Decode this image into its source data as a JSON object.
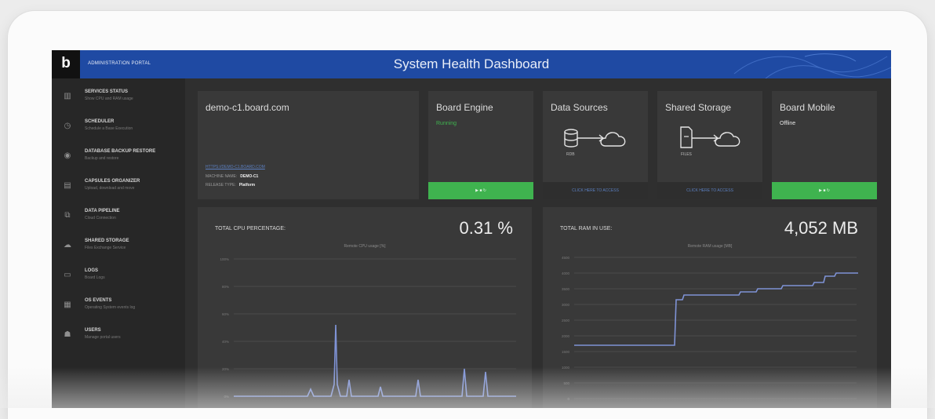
{
  "header": {
    "logo": "b",
    "portal_label": "ADMINISTRATION PORTAL",
    "title": "System Health Dashboard"
  },
  "sidebar": {
    "items": [
      {
        "icon": "bar-chart-icon",
        "title": "SERVICES STATUS",
        "subtitle": "Show CPU and RAM usage"
      },
      {
        "icon": "clock-icon",
        "title": "SCHEDULER",
        "subtitle": "Schedule a Base Execution"
      },
      {
        "icon": "database-icon",
        "title": "DATABASE BACKUP RESTORE",
        "subtitle": "Backup and restore"
      },
      {
        "icon": "folder-icon",
        "title": "CAPSULES ORGANIZER",
        "subtitle": "Upload, download and move"
      },
      {
        "icon": "pipeline-icon",
        "title": "DATA PIPELINE",
        "subtitle": "Cloud Connection"
      },
      {
        "icon": "cloud-icon",
        "title": "SHARED STORAGE",
        "subtitle": "Files Exchange Service"
      },
      {
        "icon": "file-icon",
        "title": "LOGS",
        "subtitle": "Board Logs"
      },
      {
        "icon": "calendar-icon",
        "title": "OS EVENTS",
        "subtitle": "Operating System events log"
      },
      {
        "icon": "users-icon",
        "title": "USERS",
        "subtitle": "Manage portal users"
      }
    ]
  },
  "machine": {
    "host": "demo-c1.board.com",
    "link": "HTTPS://DEMO-C1.BOARD.COM",
    "name_label": "MACHINE NAME:",
    "name_value": "DEMO-C1",
    "license_label": "RELEASE TYPE:",
    "license_value": "Platform"
  },
  "cards": {
    "engine": {
      "title": "Board Engine",
      "status": "Running",
      "footer": "▶  ■  ↻"
    },
    "data_sources": {
      "title": "Data Sources",
      "icon_label": "RDB",
      "footer": "CLICK HERE TO ACCESS"
    },
    "storage": {
      "title": "Shared Storage",
      "icon_label": "FILES",
      "footer": "CLICK HERE TO ACCESS"
    },
    "mobile": {
      "title": "Board Mobile",
      "status": "Offline",
      "footer": "▶  ■  ↻"
    }
  },
  "cpu": {
    "title": "TOTAL CPU PERCENTAGE:",
    "value": "0.31 %",
    "subtitle": "Remote CPU usage [%]",
    "y_ticks": [
      "100%",
      "80%",
      "60%",
      "40%",
      "20%",
      "0%"
    ]
  },
  "ram": {
    "title": "TOTAL RAM IN USE:",
    "value": "4,052 MB",
    "subtitle": "Remote RAM usage [MB]",
    "y_ticks": [
      "4500",
      "4000",
      "3500",
      "3000",
      "2500",
      "2000",
      "1500",
      "1000",
      "500",
      "0"
    ]
  },
  "colors": {
    "topbar": "#1f4aa3",
    "green": "#3fb34f",
    "line": "#7f93d6"
  }
}
